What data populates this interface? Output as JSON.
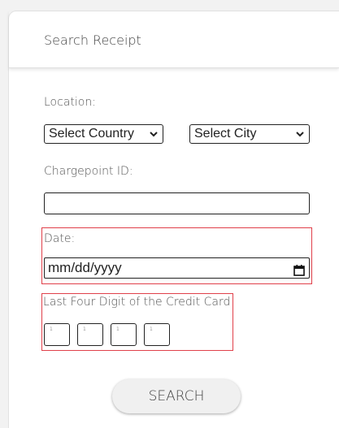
{
  "card": {
    "title": "Search Receipt"
  },
  "location": {
    "label": "Location:",
    "country_selected": "Select Country",
    "city_selected": "Select City"
  },
  "chargepoint": {
    "label": "Chargepoint ID:",
    "value": ""
  },
  "date": {
    "label": "Date:",
    "placeholder": "mm/dd/yyyy"
  },
  "credit_card": {
    "label": "Last Four Digit of the Credit Card",
    "digits": [
      "1",
      "1",
      "1",
      "1"
    ]
  },
  "actions": {
    "search_label": "SEARCH"
  },
  "colors": {
    "highlight_border": "#e0404a",
    "card_background": "#ffffff",
    "page_background": "#f2f2f2"
  },
  "icons": {
    "select_caret": "chevron-down-icon",
    "date_picker": "calendar-icon"
  }
}
